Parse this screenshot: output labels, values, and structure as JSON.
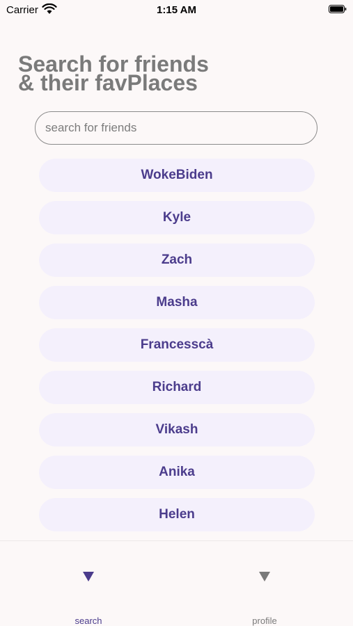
{
  "status_bar": {
    "carrier": "Carrier",
    "time": "1:15 AM"
  },
  "header": {
    "title_line1": "Search for friends",
    "title_line2": "& their favPlaces"
  },
  "search": {
    "placeholder": "search for friends",
    "value": ""
  },
  "friends": [
    "WokeBiden",
    "Kyle",
    "Zach",
    "Masha",
    "Francesscà",
    "Richard",
    "Vikash",
    "Anika",
    "Helen"
  ],
  "tab_bar": {
    "tabs": [
      {
        "label": "search",
        "icon": "triangle-down-icon",
        "active": true
      },
      {
        "label": "profile",
        "icon": "triangle-down-icon",
        "active": false
      }
    ]
  },
  "colors": {
    "accent": "#4b3c8c",
    "background": "#fcf8f8",
    "pill": "#f4f0fc",
    "title": "#7a7a7a"
  }
}
